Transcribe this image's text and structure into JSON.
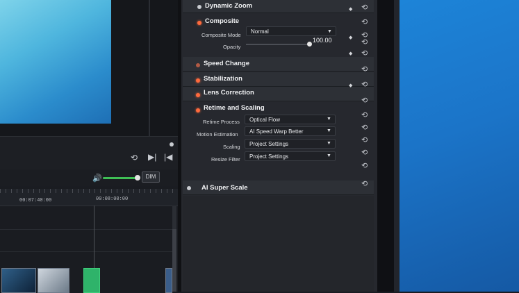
{
  "inspector": {
    "sections": {
      "dynamic_zoom": "Dynamic Zoom",
      "composite": "Composite",
      "speed_change": "Speed Change",
      "stabilization": "Stabilization",
      "lens_correction": "Lens Correction",
      "retime_and_scaling": "Retime and Scaling",
      "ai_super_scale": "AI Super Scale"
    },
    "composite": {
      "mode_label": "Composite Mode",
      "mode_value": "Normal",
      "opacity_label": "Opacity",
      "opacity_value": "100.00",
      "opacity_level": 1.0
    },
    "retime": {
      "retime_process_label": "Retime Process",
      "retime_process_value": "Optical Flow",
      "motion_estimation_label": "Motion Estimation",
      "motion_estimation_value": "AI Speed Warp Better",
      "scaling_label": "Scaling",
      "scaling_value": "Project Settings",
      "resize_filter_label": "Resize Filter",
      "resize_filter_value": "Project Settings"
    }
  },
  "audio": {
    "dim_label": "DIM",
    "volume_level": 0.95
  },
  "timeline": {
    "timecodes": [
      "00:07:40:00",
      "00:08:00:00"
    ]
  },
  "icons": {
    "reset": "reset-icon",
    "keyframe": "keyframe-diamond-icon",
    "dropdown": "chevron-down-icon",
    "speaker": "speaker-icon"
  },
  "colors": {
    "toggle_on": "#ff6a3d",
    "volume_green": "#3fbf55",
    "desktop_blue": "#1b74c8"
  }
}
